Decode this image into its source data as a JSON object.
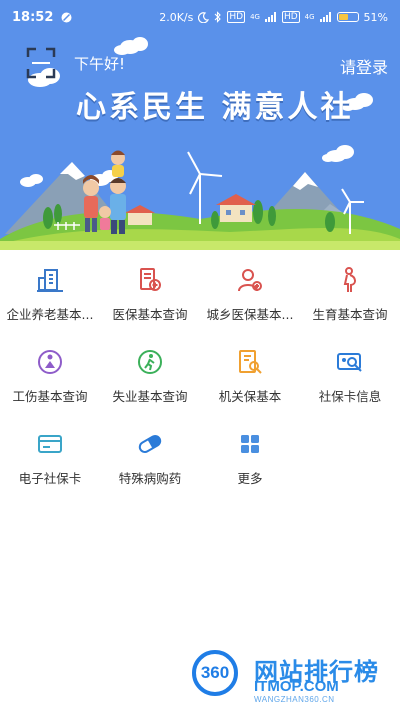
{
  "status_bar": {
    "time": "18:52",
    "network_speed": "2.0K/s",
    "battery_level": "51%",
    "battery_fraction": 0.51,
    "sim1_label": "HD",
    "sim2_label": "HD",
    "signal_type_1": "4G",
    "signal_type_2": "4G"
  },
  "header": {
    "greeting": "下午好!",
    "login_label": "请登录",
    "slogan": "心系民生  满意人社"
  },
  "services": [
    {
      "label": "企业养老基本...",
      "icon": "building-icon",
      "color": "#3a78c9"
    },
    {
      "label": "医保基本查询",
      "icon": "medical-record-icon",
      "color": "#d9534f"
    },
    {
      "label": "城乡医保基本...",
      "icon": "person-medical-icon",
      "color": "#d9534f"
    },
    {
      "label": "生育基本查询",
      "icon": "pregnancy-icon",
      "color": "#d9534f"
    },
    {
      "label": "工伤基本查询",
      "icon": "injury-icon",
      "color": "#8e5cc9"
    },
    {
      "label": "失业基本查询",
      "icon": "walking-person-icon",
      "color": "#3bb05a"
    },
    {
      "label": "机关保基本",
      "icon": "document-search-icon",
      "color": "#f0a030"
    },
    {
      "label": "社保卡信息",
      "icon": "card-search-icon",
      "color": "#2b7bd8"
    },
    {
      "label": "电子社保卡",
      "icon": "card-icon",
      "color": "#3aa5c8"
    },
    {
      "label": "特殊病购药",
      "icon": "pill-icon",
      "color": "#2b7bd8"
    },
    {
      "label": "更多",
      "icon": "grid-icon",
      "color": "#4a8fe0"
    }
  ],
  "watermark": {
    "logo_text": "360",
    "title": "网站排行榜",
    "sub": "ITMOP.COM",
    "url": "WANGZHAN360.CN"
  }
}
